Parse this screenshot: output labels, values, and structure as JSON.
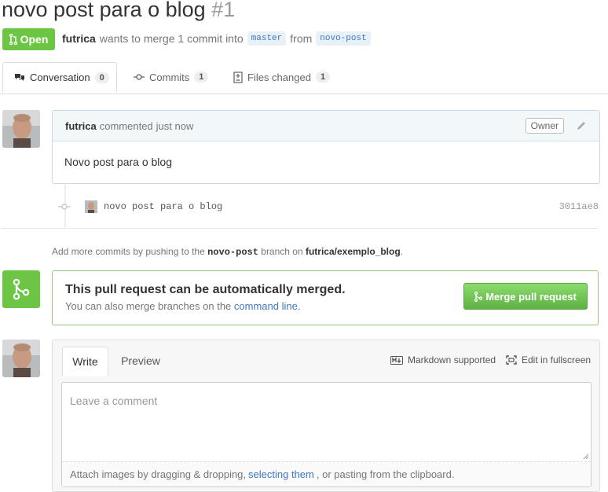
{
  "pr": {
    "title": "novo post para o blog",
    "number": "#1"
  },
  "state": {
    "label": "Open",
    "color": "#6cc644"
  },
  "meta": {
    "author": "futrica",
    "action": "wants to merge 1 commit into",
    "base": "master",
    "from": "from",
    "head": "novo-post"
  },
  "tabs": [
    {
      "label": "Conversation",
      "count": "0",
      "icon": "comment-discussion-icon"
    },
    {
      "label": "Commits",
      "count": "1",
      "icon": "git-commit-icon"
    },
    {
      "label": "Files changed",
      "count": "1",
      "icon": "diff-icon"
    }
  ],
  "comment": {
    "author": "futrica",
    "action": "commented",
    "time": "just now",
    "role": "Owner",
    "body": "Novo post para o blog"
  },
  "commit": {
    "message": "novo post para o blog",
    "sha": "3011ae8"
  },
  "hint": {
    "prefix": "Add more commits by pushing to the",
    "branch": "novo-post",
    "middle": "branch on",
    "repo": "futrica/exemplo_blog",
    "suffix": "."
  },
  "merge": {
    "title": "This pull request can be automatically merged.",
    "sub_prefix": "You can also merge branches on the",
    "sub_link": "command line",
    "sub_suffix": ".",
    "button": "Merge pull request"
  },
  "editor": {
    "write_tab": "Write",
    "preview_tab": "Preview",
    "markdown": "Markdown supported",
    "fullscreen": "Edit in fullscreen",
    "placeholder": "Leave a comment",
    "attach_prefix": "Attach images by dragging & dropping,",
    "attach_link": "selecting them",
    "attach_suffix": ", or pasting from the clipboard."
  },
  "colors": {
    "green": "#6cc644",
    "link": "#4078c0"
  }
}
